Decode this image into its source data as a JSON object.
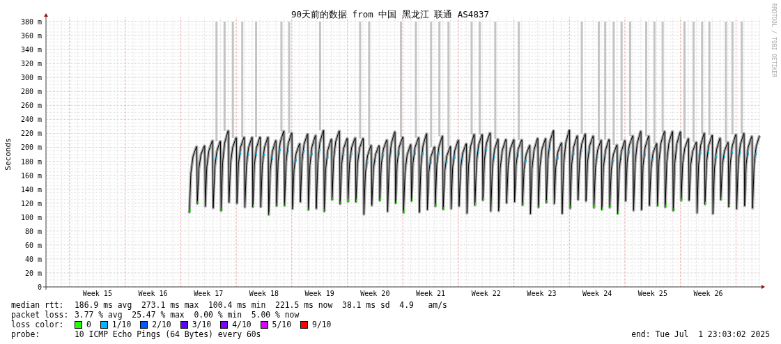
{
  "title": "90天前的数据 from 中国 黑龙江 联通 AS4837",
  "credit": "RRDTOOL / TOBI OETIKER",
  "chart": {
    "ylabel": "Seconds",
    "yticks": [
      "380 m",
      "360 m",
      "340 m",
      "320 m",
      "300 m",
      "280 m",
      "260 m",
      "240 m",
      "220 m",
      "200 m",
      "180 m",
      "160 m",
      "140 m",
      "120 m",
      "100 m",
      "80 m",
      "60 m",
      "40 m",
      "20 m",
      "0"
    ],
    "xticks": [
      "Week 15",
      "Week 16",
      "Week 17",
      "Week 18",
      "Week 19",
      "Week 20",
      "Week 21",
      "Week 22",
      "Week 23",
      "Week 24",
      "Week 25",
      "Week 26"
    ]
  },
  "legend": {
    "median_rtt": {
      "label": "median rtt:",
      "text": "186.9 ms avg  273.1 ms max  100.4 ms min  221.5 ms now  38.1 ms sd  4.9   am/s"
    },
    "packet_loss": {
      "label": "packet loss:",
      "text": "3.77 % avg  25.47 % max  0.00 % min  5.00 % now"
    },
    "loss_color": {
      "label": "loss color:",
      "items": [
        {
          "label": "0",
          "color": "#26ff00"
        },
        {
          "label": "1/10",
          "color": "#00b8ff"
        },
        {
          "label": "2/10",
          "color": "#0059ff"
        },
        {
          "label": "3/10",
          "color": "#5e00ff"
        },
        {
          "label": "4/10",
          "color": "#7e00ff"
        },
        {
          "label": "5/10",
          "color": "#dd00ff"
        },
        {
          "label": "9/10",
          "color": "#ff0000"
        }
      ]
    },
    "probe": {
      "label": "probe:",
      "text": "10 ICMP Echo Pings (64 Bytes) every 60s"
    },
    "end": "end: Tue Jul  1 23:03:02 2025"
  }
}
